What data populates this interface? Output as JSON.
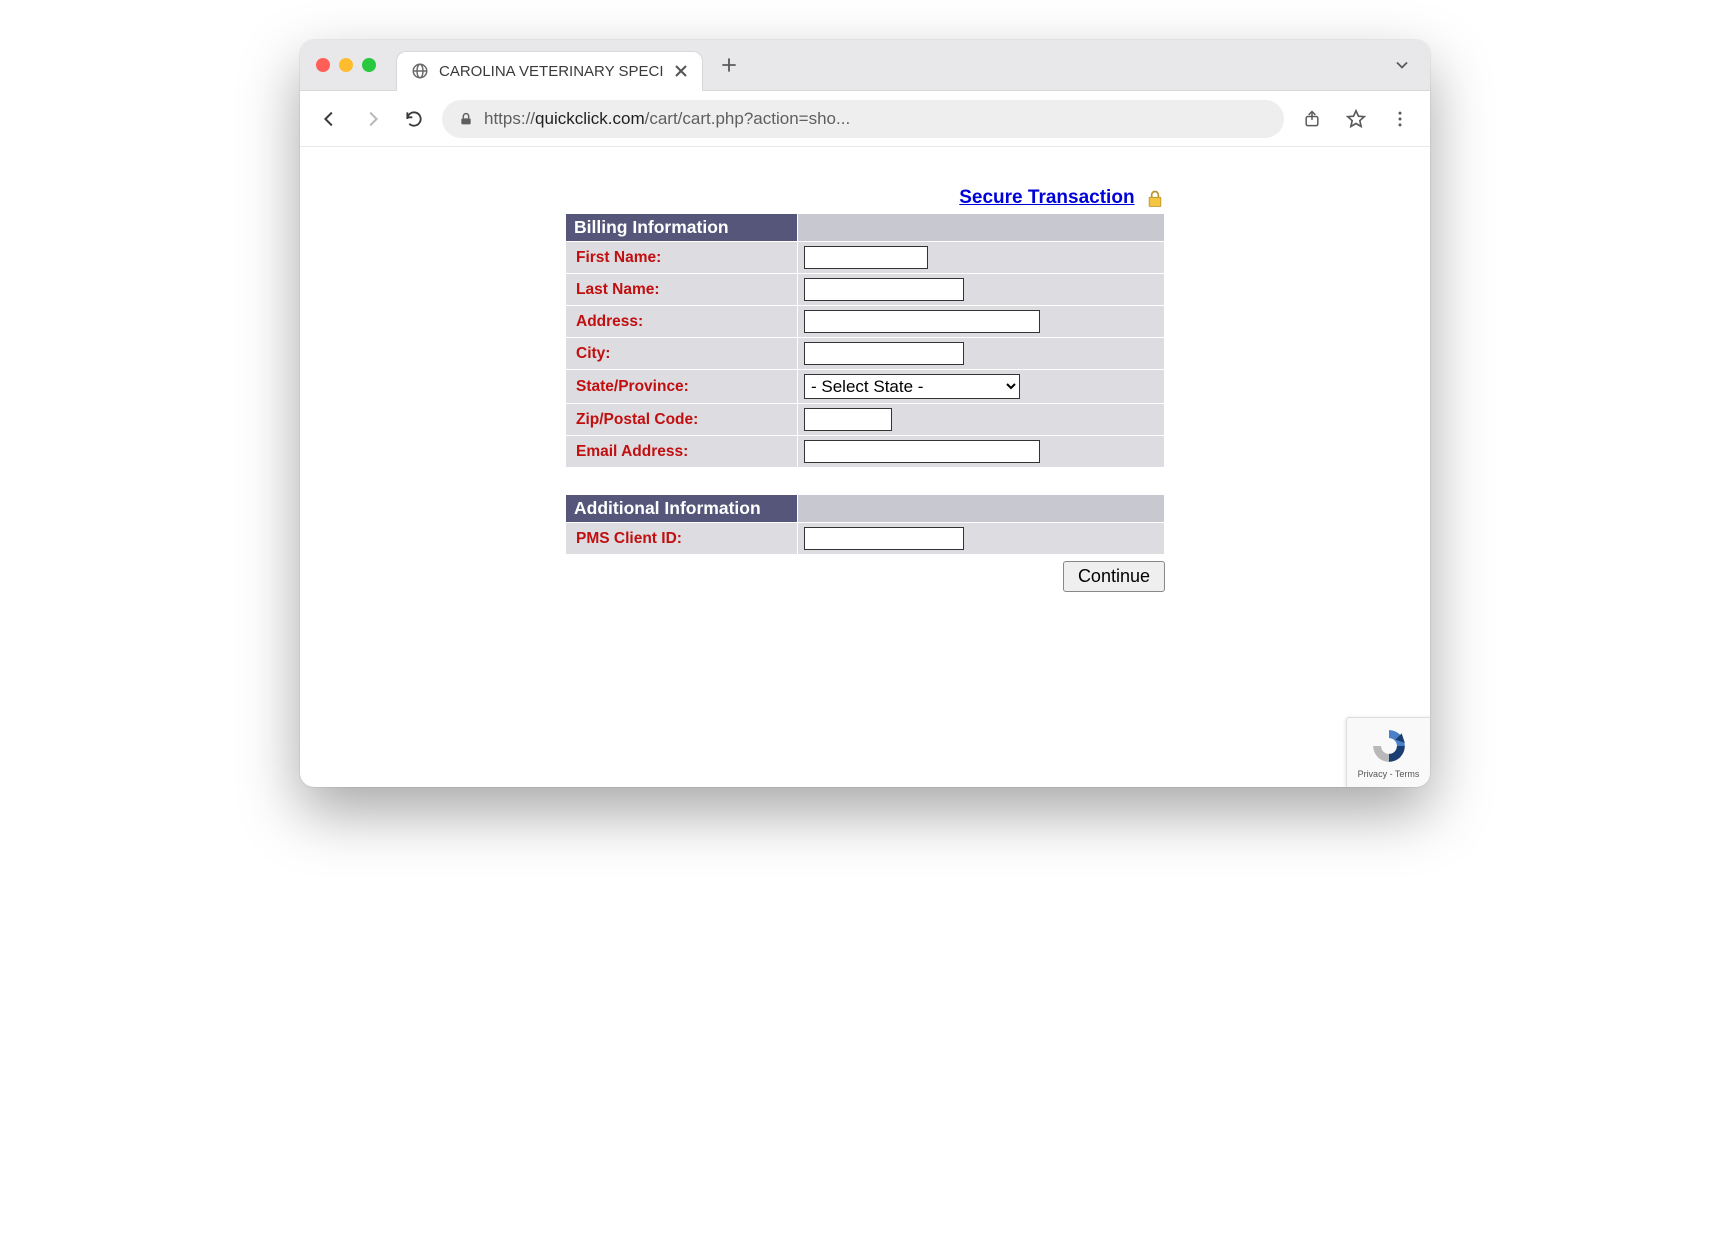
{
  "browser": {
    "tab_title": "CAROLINA VETERINARY SPECI",
    "url_display_prefix": "https://",
    "url_display_host": "quickclick.com",
    "url_display_path": "/cart/cart.php?action=sho..."
  },
  "secure_link": "Secure Transaction",
  "billing": {
    "header": "Billing Information",
    "fields": {
      "first_name": "First Name:",
      "last_name": "Last Name:",
      "address": "Address:",
      "city": "City:",
      "state": "State/Province:",
      "zip": "Zip/Postal Code:",
      "email": "Email Address:"
    },
    "state_placeholder": "- Select State -"
  },
  "additional": {
    "header": "Additional Information",
    "fields": {
      "pms": "PMS Client ID:"
    }
  },
  "continue_label": "Continue",
  "recaptcha": {
    "privacy": "Privacy",
    "terms": "Terms"
  }
}
